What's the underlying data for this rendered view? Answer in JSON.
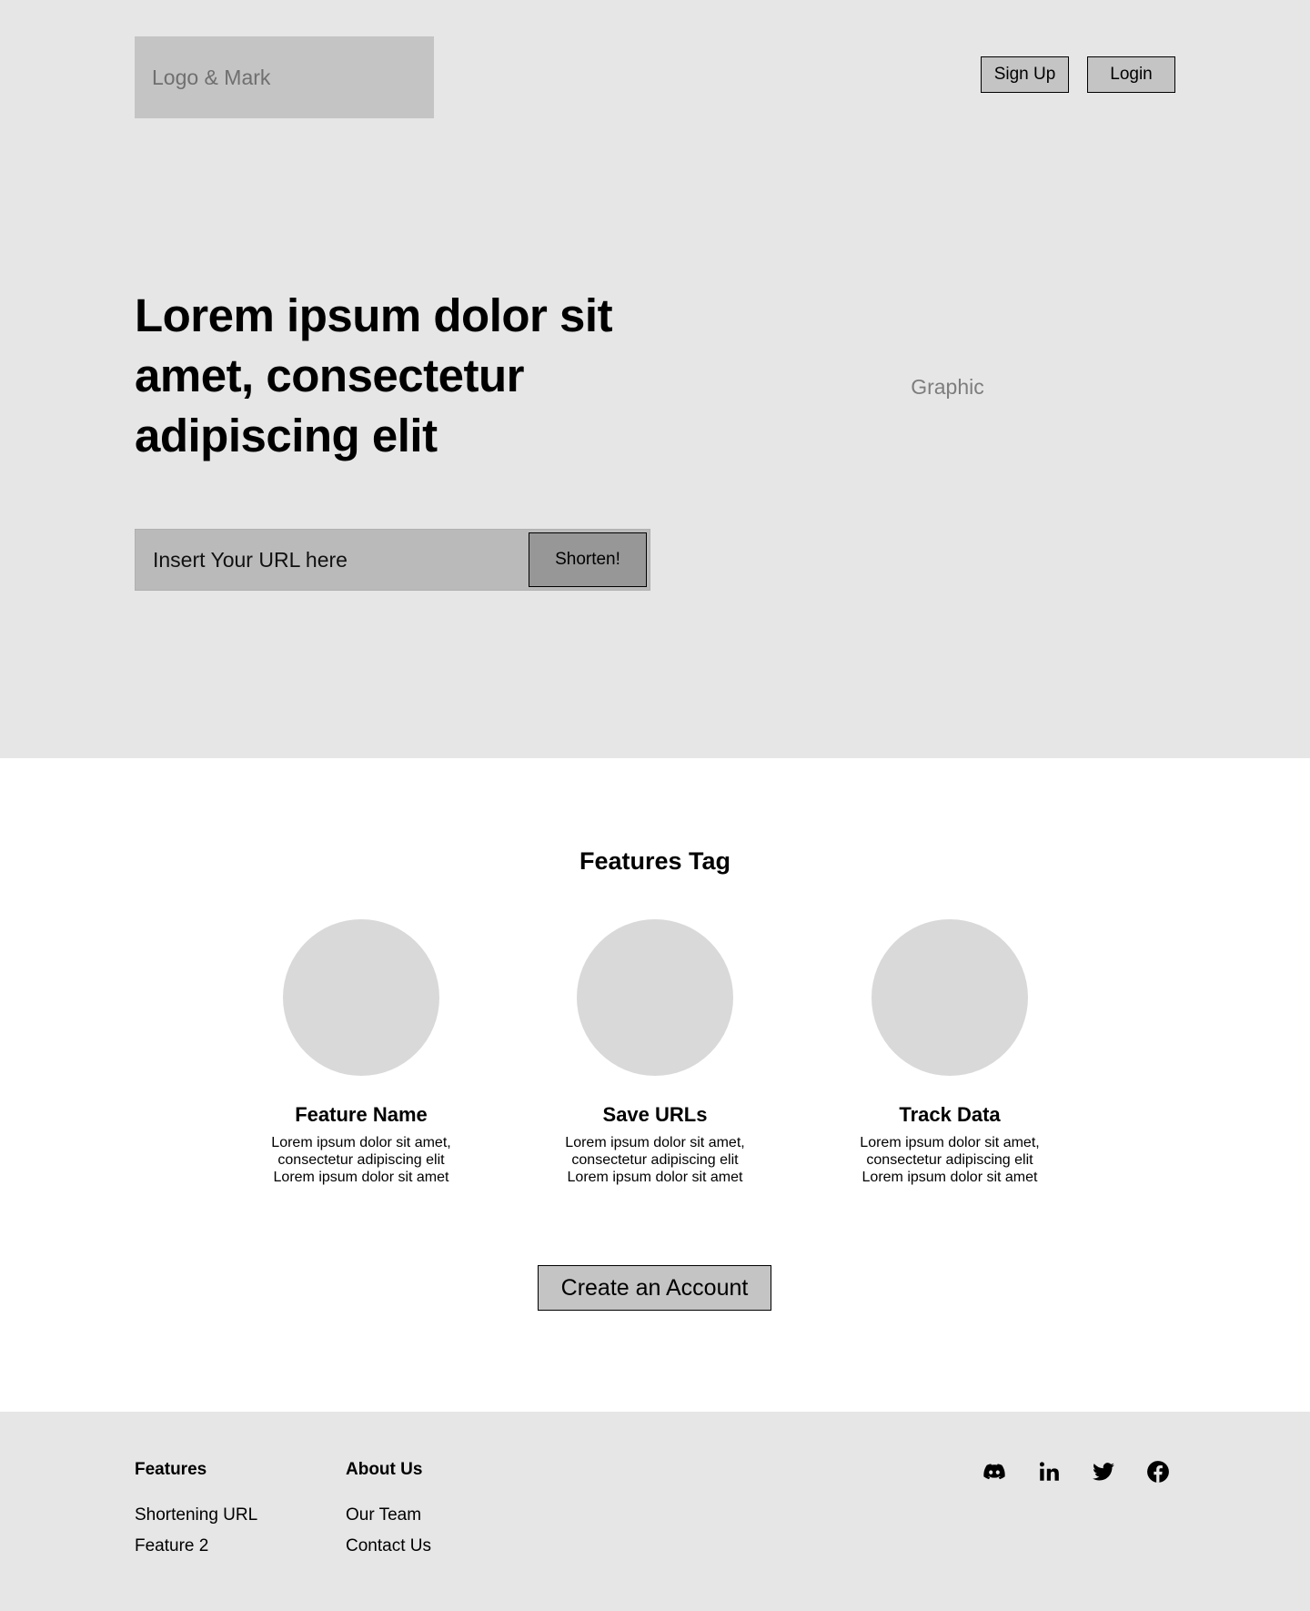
{
  "header": {
    "logo_text": "Logo & Mark",
    "signup_label": "Sign Up",
    "login_label": "Login"
  },
  "hero": {
    "headline": "Lorem ipsum dolor sit amet, consectetur adipiscing elit",
    "url_placeholder": "Insert Your URL here",
    "shorten_label": "Shorten!",
    "graphic_label": "Graphic"
  },
  "features": {
    "title": "Features Tag",
    "items": [
      {
        "name": "Feature Name",
        "description": "Lorem ipsum dolor sit amet, consectetur adipiscing elit Lorem ipsum dolor sit amet"
      },
      {
        "name": "Save URLs",
        "description": "Lorem ipsum dolor sit amet, consectetur adipiscing elit Lorem ipsum dolor sit amet"
      },
      {
        "name": "Track Data",
        "description": "Lorem ipsum dolor sit amet, consectetur adipiscing elit Lorem ipsum dolor sit amet"
      }
    ],
    "cta_label": "Create an Account"
  },
  "footer": {
    "columns": [
      {
        "heading": "Features",
        "links": [
          "Shortening URL",
          "Feature 2"
        ]
      },
      {
        "heading": "About Us",
        "links": [
          "Our Team",
          "Contact Us"
        ]
      }
    ],
    "socials": [
      "discord-icon",
      "linkedin-icon",
      "twitter-icon",
      "facebook-icon"
    ]
  },
  "colors": {
    "hero_bg": "#e6e6e6",
    "placeholder_fill": "#c4c4c4",
    "url_bar": "#bababa",
    "shorten_button": "#979797",
    "feature_circle": "#d9d9d9"
  }
}
